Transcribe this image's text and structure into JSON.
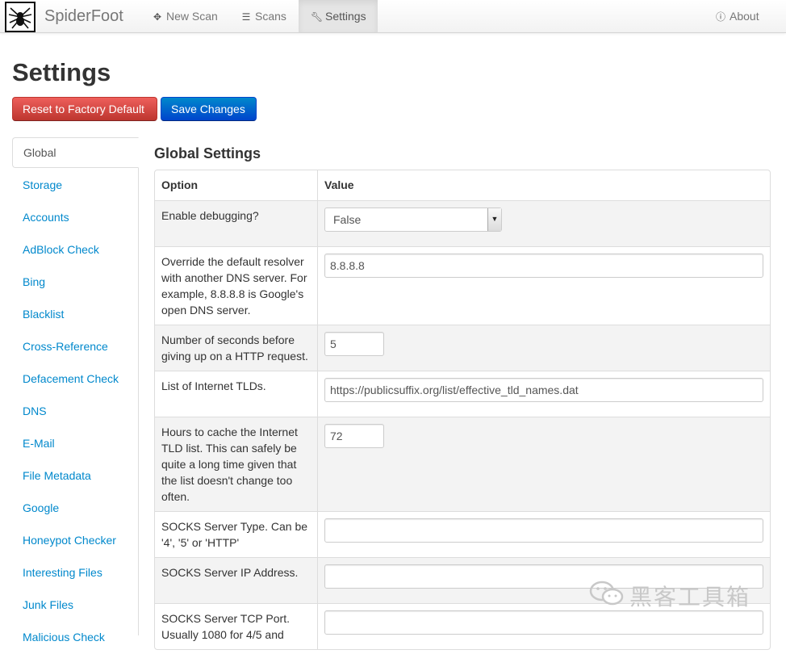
{
  "app": {
    "brand": "SpiderFoot"
  },
  "nav": {
    "new_scan": "New Scan",
    "scans": "Scans",
    "settings": "Settings",
    "about": "About"
  },
  "page": {
    "title": "Settings"
  },
  "buttons": {
    "reset": "Reset to Factory Default",
    "save": "Save Changes"
  },
  "sidebar": {
    "items": [
      "Global",
      "Storage",
      "Accounts",
      "AdBlock Check",
      "Bing",
      "Blacklist",
      "Cross-Reference",
      "Defacement Check",
      "DNS",
      "E-Mail",
      "File Metadata",
      "Google",
      "Honeypot Checker",
      "Interesting Files",
      "Junk Files",
      "Malicious Check"
    ],
    "active_index": 0
  },
  "section": {
    "title": "Global Settings",
    "headers": {
      "option": "Option",
      "value": "Value"
    },
    "rows": [
      {
        "option": "Enable debugging?",
        "type": "select",
        "value": "False"
      },
      {
        "option": "Override the default resolver with another DNS server. For example, 8.8.8.8 is Google's open DNS server.",
        "type": "text-wide",
        "value": "8.8.8.8"
      },
      {
        "option": "Number of seconds before giving up on a HTTP request.",
        "type": "text-narrow",
        "value": "5"
      },
      {
        "option": "List of Internet TLDs.",
        "type": "text-wide",
        "value": "https://publicsuffix.org/list/effective_tld_names.dat"
      },
      {
        "option": "Hours to cache the Internet TLD list. This can safely be quite a long time given that the list doesn't change too often.",
        "type": "text-narrow",
        "value": "72"
      },
      {
        "option": "SOCKS Server Type. Can be '4', '5' or 'HTTP'",
        "type": "text-wide",
        "value": ""
      },
      {
        "option": "SOCKS Server IP Address.",
        "type": "text-wide",
        "value": ""
      },
      {
        "option": "SOCKS Server TCP Port. Usually 1080 for 4/5 and",
        "type": "text-wide",
        "value": ""
      }
    ]
  },
  "watermark": {
    "text": "黑客工具箱"
  },
  "colors": {
    "link": "#0088cc",
    "danger": "#da4f49",
    "primary": "#006dcc"
  }
}
